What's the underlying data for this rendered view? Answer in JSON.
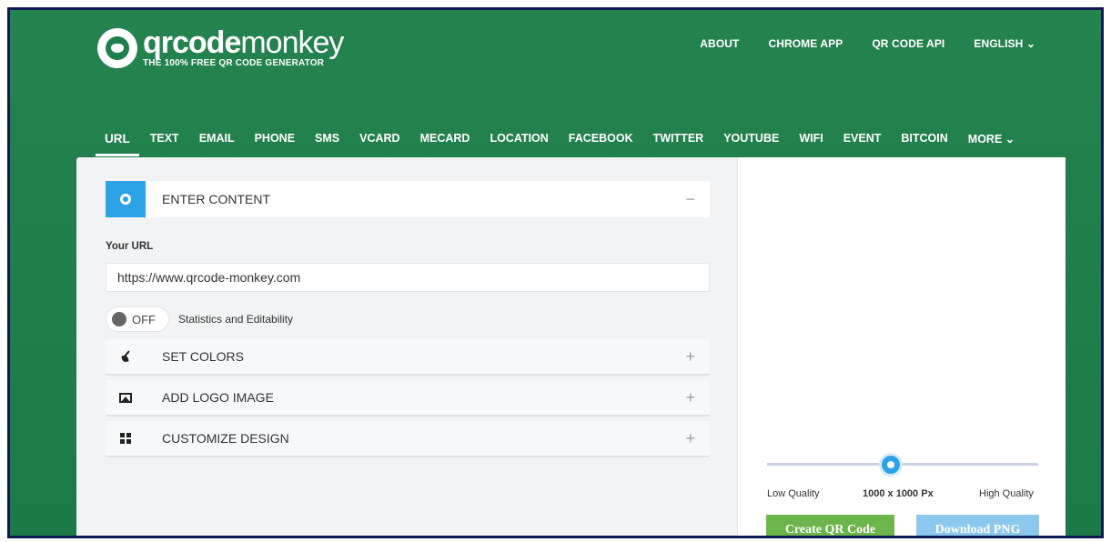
{
  "header": {
    "brand_bold": "qrcode",
    "brand_light": "monkey",
    "tagline": "THE 100% FREE QR CODE GENERATOR",
    "top_nav": [
      "ABOUT",
      "CHROME APP",
      "QR CODE API",
      "ENGLISH ⌄"
    ]
  },
  "type_tabs": [
    "URL",
    "TEXT",
    "EMAIL",
    "PHONE",
    "SMS",
    "VCARD",
    "MECARD",
    "LOCATION",
    "FACEBOOK",
    "TWITTER",
    "YOUTUBE",
    "WIFI",
    "EVENT",
    "BITCOIN",
    "MORE ⌄"
  ],
  "active_tab": "URL",
  "content": {
    "section_title": "ENTER CONTENT",
    "section_toggle": "−",
    "url_label": "Your URL",
    "url_value": "https://www.qrcode-monkey.com",
    "switch_state": "OFF",
    "switch_label": "Statistics and Editability"
  },
  "sections": [
    {
      "label": "SET COLORS",
      "icon": "brush-icon",
      "toggle": "+"
    },
    {
      "label": "ADD LOGO IMAGE",
      "icon": "image-icon",
      "toggle": "+"
    },
    {
      "label": "CUSTOMIZE DESIGN",
      "icon": "qr-design-icon",
      "toggle": "+"
    }
  ],
  "quality": {
    "low_label": "Low Quality",
    "value_label": "1000 x 1000 Px",
    "high_label": "High Quality"
  },
  "buttons": {
    "create": "Create QR Code",
    "download": "Download PNG"
  },
  "colors": {
    "header_green": "#1f7f4c",
    "accent_blue": "#2ea2e6",
    "create_green": "#6bb54a",
    "download_blue": "#8cc8ee"
  }
}
